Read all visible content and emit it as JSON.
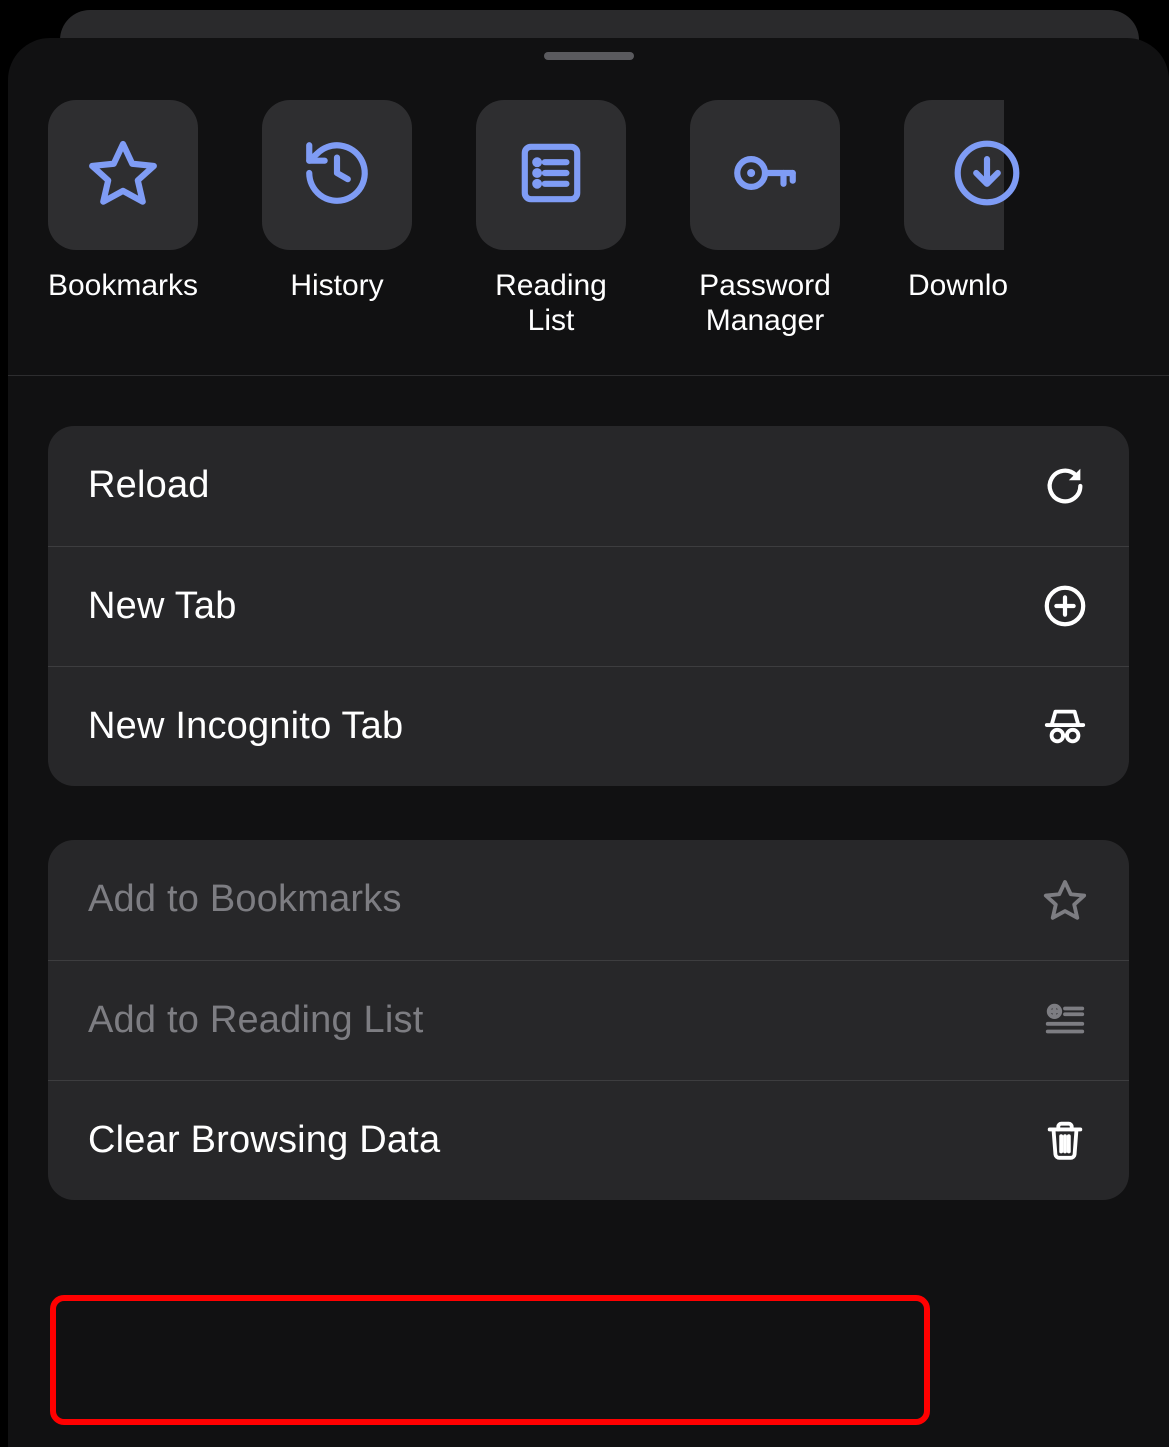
{
  "colors": {
    "accent": "#7f9cf5"
  },
  "top": {
    "items": [
      {
        "label": "Bookmarks",
        "icon": "star-icon"
      },
      {
        "label": "History",
        "icon": "history-icon"
      },
      {
        "label": "Reading List",
        "icon": "reading-list-icon"
      },
      {
        "label": "Password\nManager",
        "icon": "key-icon"
      },
      {
        "label": "Downlo",
        "icon": "download-icon",
        "partial": true
      }
    ]
  },
  "group1": {
    "rows": [
      {
        "label": "Reload",
        "icon": "reload-icon"
      },
      {
        "label": "New Tab",
        "icon": "new-tab-icon"
      },
      {
        "label": "New Incognito Tab",
        "icon": "incognito-icon"
      }
    ]
  },
  "group2": {
    "rows": [
      {
        "label": "Add to Bookmarks",
        "icon": "star-outline-icon",
        "disabled": true
      },
      {
        "label": "Add to Reading List",
        "icon": "add-reading-list-icon",
        "disabled": true
      },
      {
        "label": "Clear Browsing Data",
        "icon": "trash-icon",
        "highlighted": true
      }
    ]
  }
}
